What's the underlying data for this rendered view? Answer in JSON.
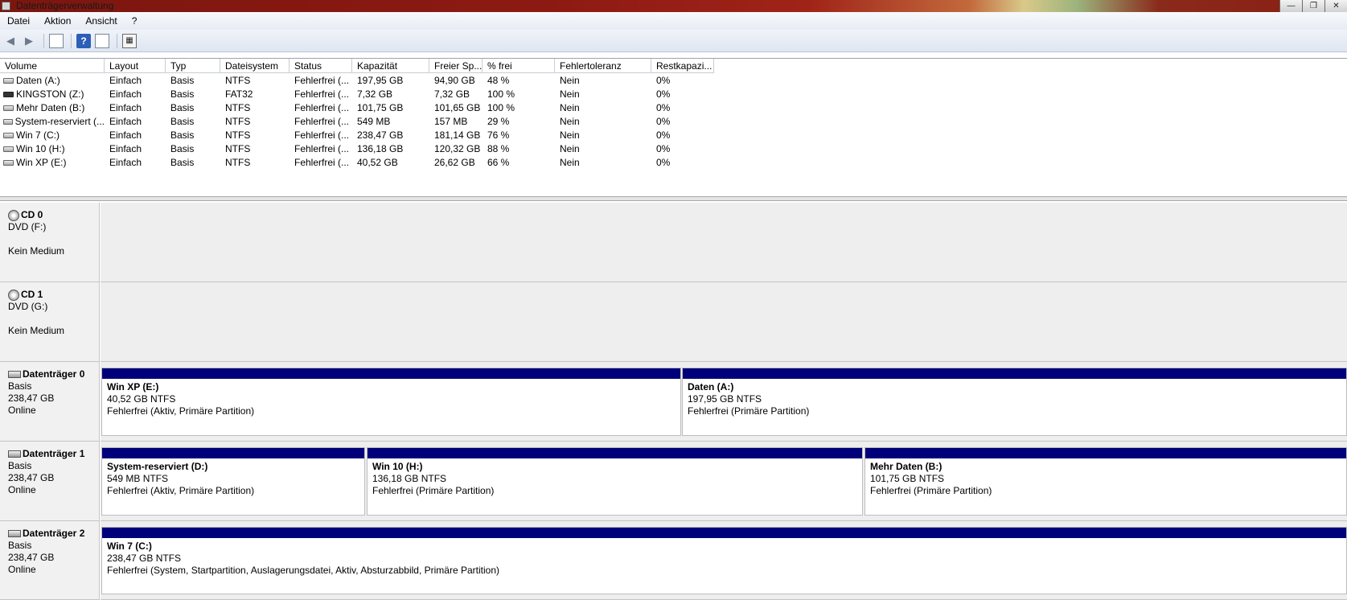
{
  "window": {
    "title": "Datenträgerverwaltung",
    "min_glyph": "—",
    "max_glyph": "❐",
    "close_glyph": "✕"
  },
  "menu": [
    "Datei",
    "Aktion",
    "Ansicht",
    "?"
  ],
  "toolbar": {
    "icons": [
      "back-arrow-icon",
      "forward-arrow-icon",
      "show-hide-tree-icon",
      "help-icon",
      "console-view-icon",
      "properties-icon"
    ]
  },
  "list": {
    "columns": [
      "Volume",
      "Layout",
      "Typ",
      "Dateisystem",
      "Status",
      "Kapazität",
      "Freier Sp...",
      "% frei",
      "Fehlertoleranz",
      "Restkapazi..."
    ],
    "rows": [
      [
        "Daten (A:)",
        "Einfach",
        "Basis",
        "NTFS",
        "Fehlerfrei (...",
        "197,95 GB",
        "94,90 GB",
        "48 %",
        "Nein",
        "0%"
      ],
      [
        "KINGSTON (Z:)",
        "Einfach",
        "Basis",
        "FAT32",
        "Fehlerfrei (...",
        "7,32 GB",
        "7,32 GB",
        "100 %",
        "Nein",
        "0%"
      ],
      [
        "Mehr Daten (B:)",
        "Einfach",
        "Basis",
        "NTFS",
        "Fehlerfrei (...",
        "101,75 GB",
        "101,65 GB",
        "100 %",
        "Nein",
        "0%"
      ],
      [
        "System-reserviert (...",
        "Einfach",
        "Basis",
        "NTFS",
        "Fehlerfrei (...",
        "549 MB",
        "157 MB",
        "29 %",
        "Nein",
        "0%"
      ],
      [
        "Win 7 (C:)",
        "Einfach",
        "Basis",
        "NTFS",
        "Fehlerfrei (...",
        "238,47 GB",
        "181,14 GB",
        "76 %",
        "Nein",
        "0%"
      ],
      [
        "Win 10 (H:)",
        "Einfach",
        "Basis",
        "NTFS",
        "Fehlerfrei (...",
        "136,18 GB",
        "120,32 GB",
        "88 %",
        "Nein",
        "0%"
      ],
      [
        "Win XP (E:)",
        "Einfach",
        "Basis",
        "NTFS",
        "Fehlerfrei (...",
        "40,52 GB",
        "26,62 GB",
        "66 %",
        "Nein",
        "0%"
      ]
    ]
  },
  "disks": [
    {
      "name": "CD 0",
      "line1": "DVD (F:)",
      "line2": "",
      "line3": "Kein Medium",
      "partitions": []
    },
    {
      "name": "CD 1",
      "line1": "DVD (G:)",
      "line2": "",
      "line3": "Kein Medium",
      "partitions": []
    },
    {
      "name": "Datenträger 0",
      "line1": "Basis",
      "line2": "238,47 GB",
      "line3": "Online",
      "partitions": [
        {
          "title": "Win XP  (E:)",
          "size": "40,52 GB NTFS",
          "status": "Fehlerfrei (Aktiv, Primäre Partition)"
        },
        {
          "title": "Daten  (A:)",
          "size": "197,95 GB NTFS",
          "status": "Fehlerfrei (Primäre Partition)"
        }
      ]
    },
    {
      "name": "Datenträger 1",
      "line1": "Basis",
      "line2": "238,47 GB",
      "line3": "Online",
      "partitions": [
        {
          "title": "System-reserviert  (D:)",
          "size": "549 MB NTFS",
          "status": "Fehlerfrei (Aktiv, Primäre Partition)"
        },
        {
          "title": "Win 10  (H:)",
          "size": "136,18 GB NTFS",
          "status": "Fehlerfrei (Primäre Partition)"
        },
        {
          "title": "Mehr Daten  (B:)",
          "size": "101,75 GB NTFS",
          "status": "Fehlerfrei (Primäre Partition)"
        }
      ]
    },
    {
      "name": "Datenträger 2",
      "line1": "Basis",
      "line2": "238,47 GB",
      "line3": "Online",
      "partitions": [
        {
          "title": "Win 7  (C:)",
          "size": "238,47 GB NTFS",
          "status": "Fehlerfrei (System, Startpartition, Auslagerungsdatei, Aktiv, Absturzabbild, Primäre Partition)"
        }
      ]
    }
  ],
  "colors": {
    "partition_bar": "#00007a",
    "disk_label_bg": "#f1f1f1"
  }
}
